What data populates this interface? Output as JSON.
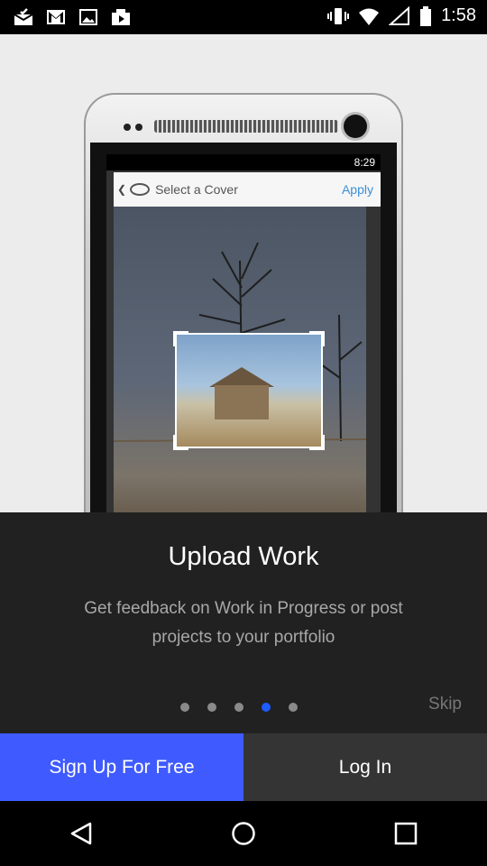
{
  "status_bar": {
    "time": "1:58",
    "icons": [
      "mail-check-icon",
      "gmail-icon",
      "image-icon",
      "photos-icon",
      "vibrate-icon",
      "wifi-icon",
      "signal-icon",
      "battery-icon"
    ]
  },
  "illustration": {
    "mini_time": "8:29",
    "mini_title": "Select a Cover",
    "mini_action": "Apply"
  },
  "onboarding": {
    "title": "Upload Work",
    "description": "Get feedback on Work in Progress or post projects to your portfolio",
    "skip_label": "Skip",
    "page_count": 5,
    "active_page": 4
  },
  "actions": {
    "signup_label": "Sign Up For Free",
    "login_label": "Log In"
  },
  "colors": {
    "accent": "#3f5bff",
    "active_dot": "#1e5cff",
    "panel": "#212121"
  },
  "nav_bar": [
    "back-icon",
    "home-icon",
    "recents-icon"
  ]
}
